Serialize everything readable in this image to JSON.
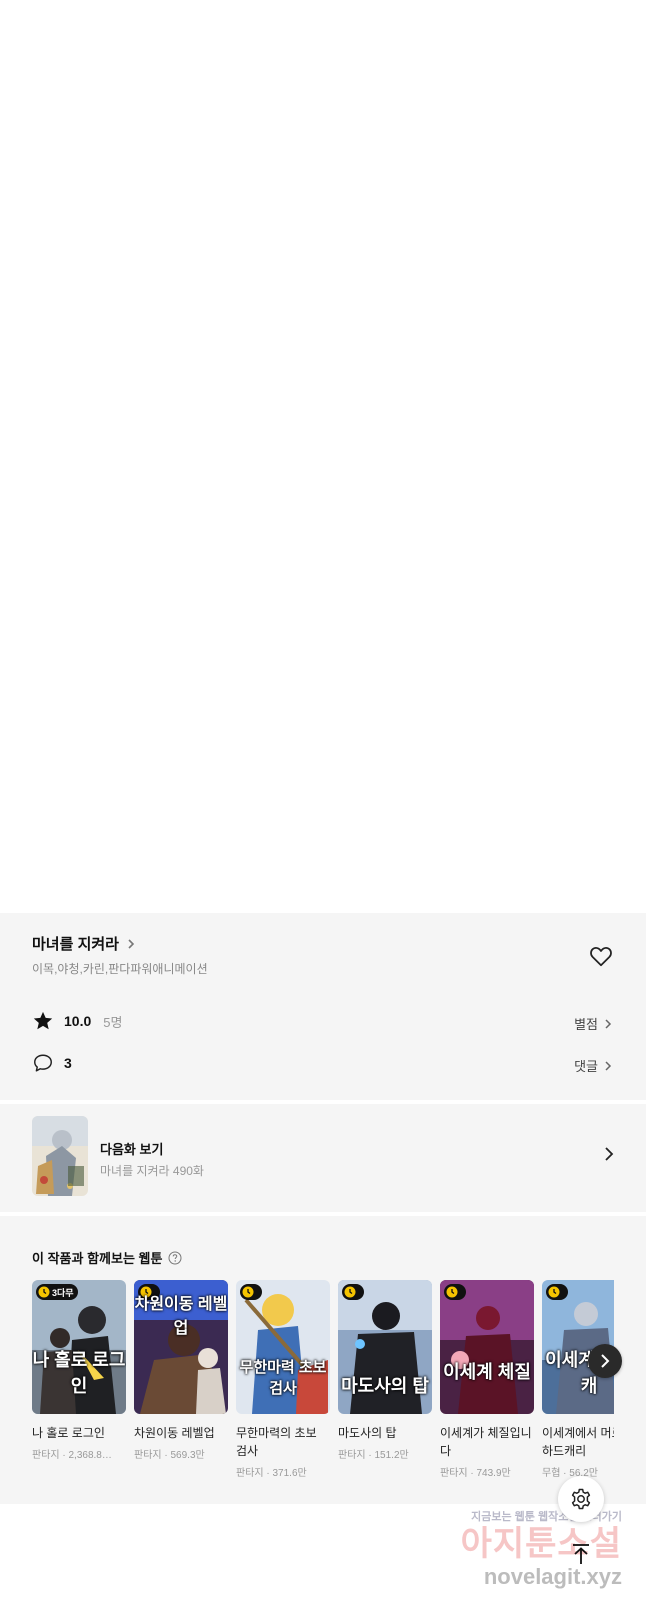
{
  "series_info": {
    "title": "마녀를 지켜라",
    "authors": "이목,야청,카린,판다파워애니메이션",
    "rating": "10.0",
    "rating_count": "5명",
    "rating_link": "별점",
    "comment_count": "3",
    "comment_link": "댓글"
  },
  "next_episode": {
    "label": "다음화 보기",
    "subtitle": "마녀를 지켜라 490화"
  },
  "recommendations": {
    "heading": "이 작품과 함께보는 웹툰",
    "items": [
      {
        "name": "나 홀로 로그인",
        "genre": "판타지",
        "views": "2,368.8…",
        "badge": "3다무",
        "cover_text": "나 홀로 로그인"
      },
      {
        "name": "차원이동 레벨업",
        "genre": "판타지",
        "views": "569.3만",
        "badge": "",
        "cover_text": "차원이동 레벨업"
      },
      {
        "name": "무한마력의 초보 검사",
        "genre": "판타지",
        "views": "371.6만",
        "badge": "",
        "cover_text": "무한마력 초보검사"
      },
      {
        "name": "마도사의 탑",
        "genre": "판타지",
        "views": "151.2만",
        "badge": "",
        "cover_text": "마도사의 탑"
      },
      {
        "name": "이세계가 체질입니다",
        "genre": "판타지",
        "views": "743.9만",
        "badge": "",
        "cover_text": "이세계 체질"
      },
      {
        "name": "이세계에서 머로 하드캐리",
        "genre": "무협",
        "views": "56.2만",
        "badge": "",
        "cover_text": "이세계 하드캐"
      }
    ]
  },
  "watermark": {
    "line1": "지금보는 웹툰 웹작소설 보러가기",
    "line2": "아지툰소설",
    "line3": "novelagit.xyz"
  },
  "colors": {
    "panel_bg": "#f5f5f5",
    "badge_bg": "#111111",
    "clock_accent": "#f5c400"
  }
}
